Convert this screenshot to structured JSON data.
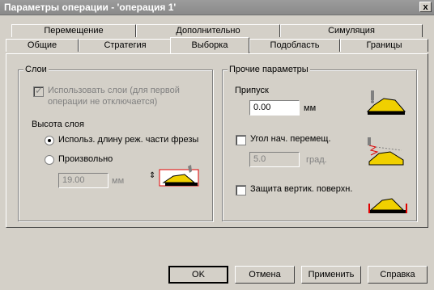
{
  "window": {
    "title": "Параметры операции - 'операция 1'",
    "close": "x"
  },
  "tabs_row1": [
    "Перемещение",
    "Дополнительно",
    "Симуляция"
  ],
  "tabs_row2": [
    "Общие",
    "Стратегия",
    "Выборка",
    "Подобласть",
    "Границы"
  ],
  "layers": {
    "legend": "Слои",
    "use_layers_line1": "Использовать слои (для первой",
    "use_layers_line2": "операции не отключается)",
    "height_label": "Высота слоя",
    "radio_length": "Использ. длину реж. части фрезы",
    "radio_custom": "Произвольно",
    "custom_value": "19.00",
    "custom_unit": "мм"
  },
  "other": {
    "legend": "Прочие параметры",
    "allowance_label": "Припуск",
    "allowance_value": "0.00",
    "allowance_unit": "мм",
    "angle_label": "Угол нач. перемещ.",
    "angle_value": "5.0",
    "angle_unit": "град.",
    "vertical_label": "Защита вертик. поверхн."
  },
  "buttons": {
    "ok": "OK",
    "cancel": "Отмена",
    "apply": "Применить",
    "help": "Справка"
  }
}
